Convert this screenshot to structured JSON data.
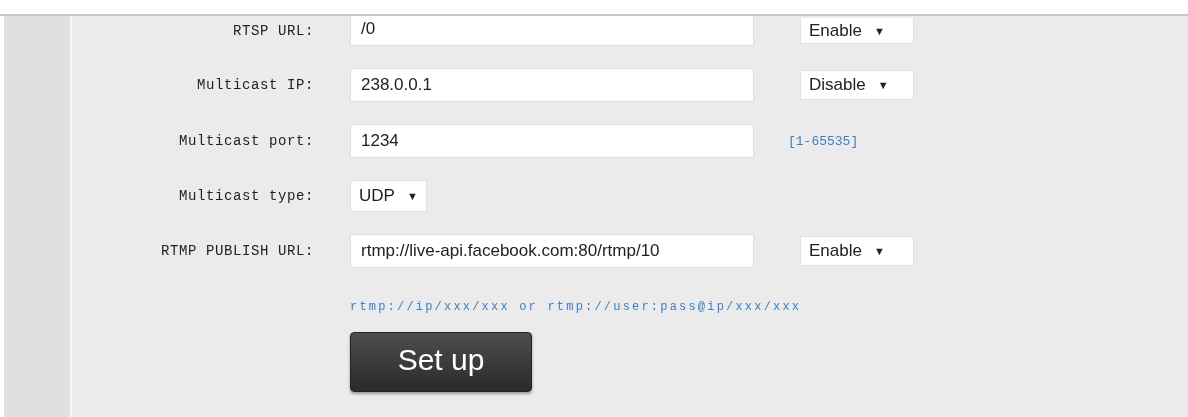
{
  "form": {
    "rows": [
      {
        "kind": "text",
        "label": "RTSP URL:",
        "value": "/0",
        "select": {
          "value": "Enable",
          "arrow": "▼"
        }
      },
      {
        "kind": "text",
        "label": "Multicast IP:",
        "value": "238.0.0.1",
        "select": {
          "value": "Disable",
          "arrow": "▼"
        }
      },
      {
        "kind": "text",
        "label": "Multicast port:",
        "value": "1234",
        "hint": "[1-65535]"
      },
      {
        "kind": "select",
        "label": "Multicast type:",
        "select": {
          "value": "UDP",
          "arrow": "▼"
        }
      },
      {
        "kind": "text",
        "label": "RTMP PUBLISH URL:",
        "value": "rtmp://live-api.facebook.com:80/rtmp/10",
        "select": {
          "value": "Enable",
          "arrow": "▼"
        }
      }
    ],
    "note": "rtmp://ip/xxx/xxx or rtmp://user:pass@ip/xxx/xxx",
    "button": "Set up"
  }
}
